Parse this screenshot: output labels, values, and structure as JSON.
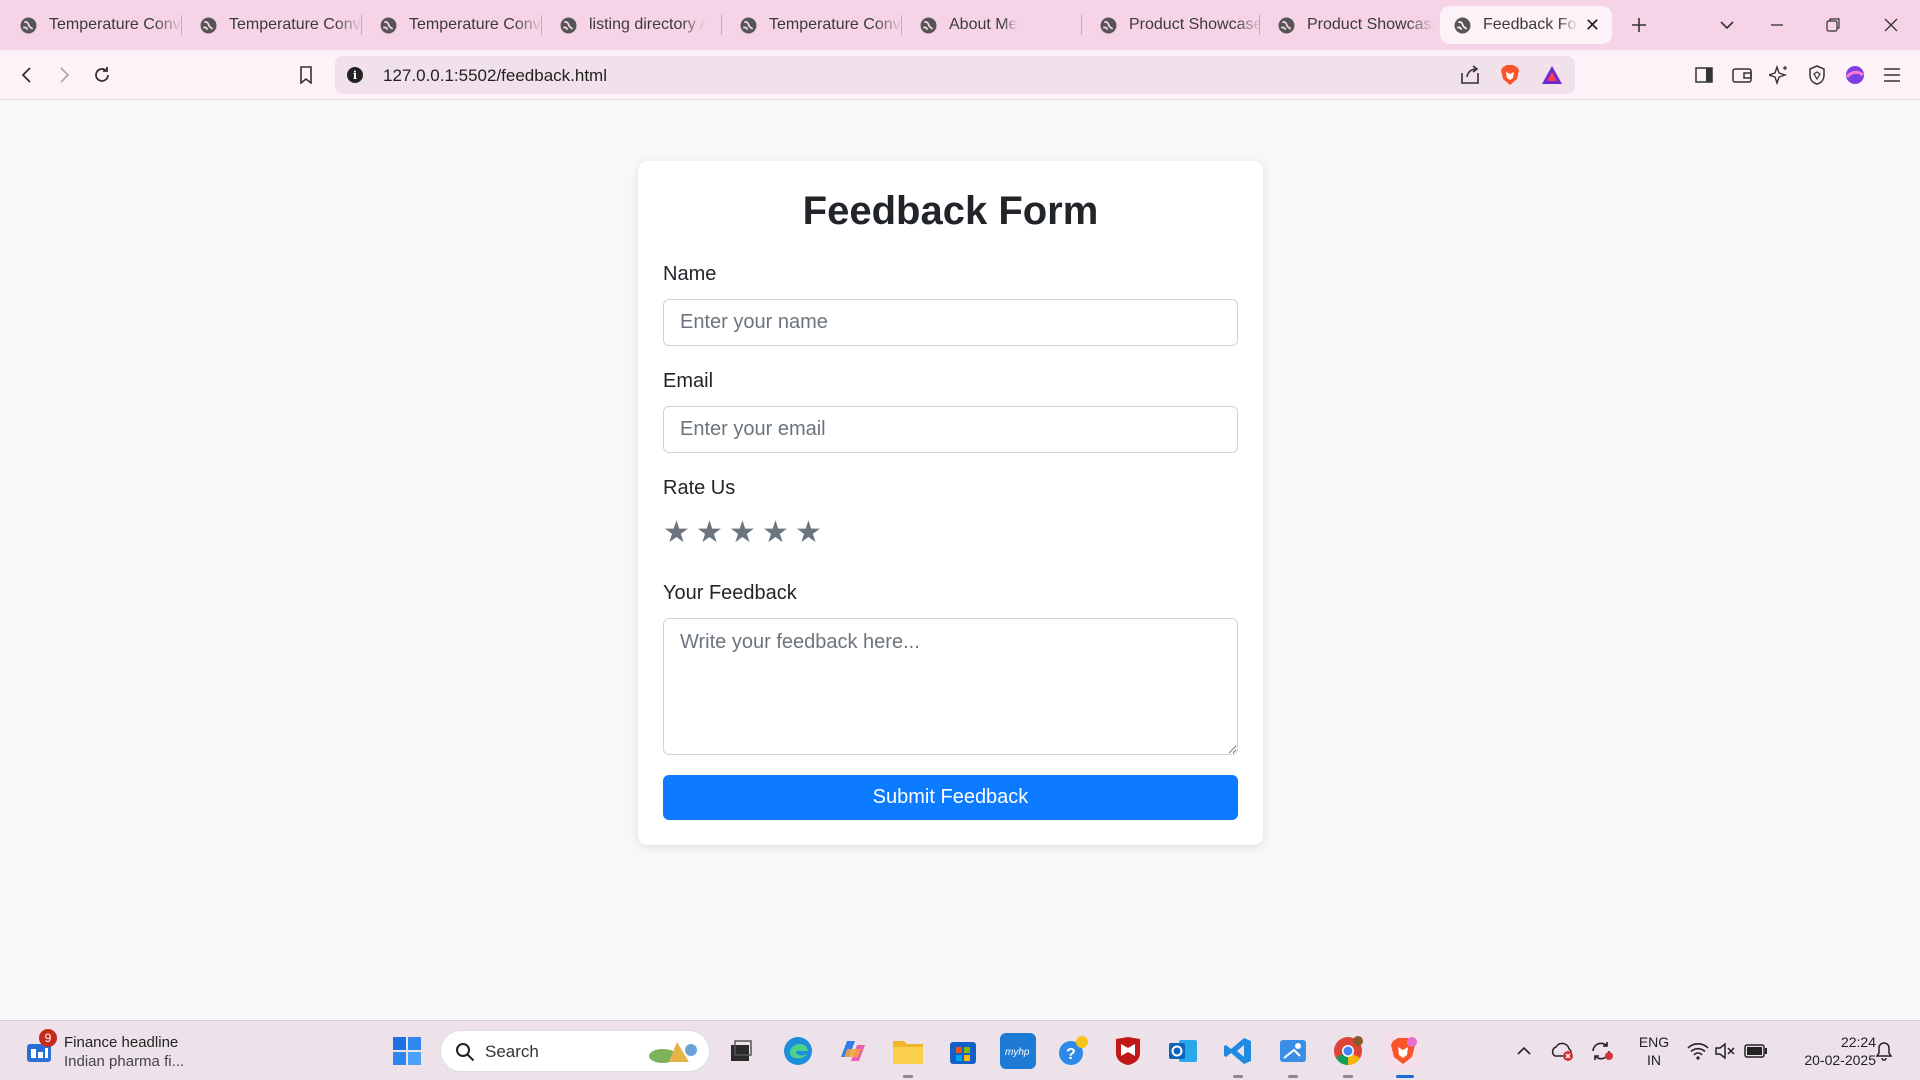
{
  "browser": {
    "tabs": [
      {
        "label": "Temperature Converter"
      },
      {
        "label": "Temperature Converter"
      },
      {
        "label": "Temperature Converter"
      },
      {
        "label": "listing directory /"
      },
      {
        "label": "Temperature Converter"
      },
      {
        "label": "About Me"
      },
      {
        "label": "Product Showcase"
      },
      {
        "label": "Product Showcase"
      },
      {
        "label": "Feedback Form",
        "active": true
      }
    ],
    "url": "127.0.0.1:5502/feedback.html"
  },
  "form": {
    "title": "Feedback Form",
    "name_label": "Name",
    "name_placeholder": "Enter your name",
    "email_label": "Email",
    "email_placeholder": "Enter your email",
    "rating_label": "Rate Us",
    "stars": [
      "★",
      "★",
      "★",
      "★",
      "★"
    ],
    "rating_value": 0,
    "feedback_label": "Your Feedback",
    "feedback_placeholder": "Write your feedback here...",
    "submit_label": "Submit Feedback"
  },
  "taskbar": {
    "news_badge": "9",
    "news_title": "Finance headline",
    "news_subtitle": "Indian pharma fi...",
    "search_label": "Search",
    "lang_line1": "ENG",
    "lang_line2": "IN",
    "time": "22:24",
    "date": "20-02-2025"
  },
  "colors": {
    "accent": "#0d7bff",
    "tabstrip": "#f6d3e6",
    "page_bg": "#f7f8fa"
  }
}
